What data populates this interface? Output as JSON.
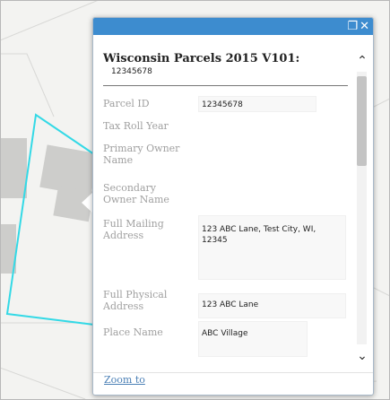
{
  "popup": {
    "title": "Wisconsin Parcels 2015 V101:",
    "subtitle": "12345678",
    "maximize_icon": "maximize-icon",
    "close_icon": "close-icon",
    "fields": [
      {
        "label": "Parcel ID",
        "value": "12345678"
      },
      {
        "label": "Tax Roll Year",
        "value": ""
      },
      {
        "label": "Primary Owner Name",
        "value": ""
      },
      {
        "label": "Secondary Owner Name",
        "value": ""
      },
      {
        "label": "Full Mailing Address",
        "value": "123 ABC Lane, Test City, WI, 12345"
      },
      {
        "label": "Full Physical Address",
        "value": "123 ABC Lane"
      },
      {
        "label": "Place Name",
        "value": "ABC Village"
      }
    ],
    "zoom_link": "Zoom to",
    "scroll_up_icon": "chevron-up-icon",
    "scroll_down_icon": "chevron-down-icon"
  },
  "colors": {
    "titlebar": "#3d8ccf",
    "parcel_outline": "#33d9e6",
    "label_text": "#a0a0a0",
    "link": "#4a7fb5"
  }
}
